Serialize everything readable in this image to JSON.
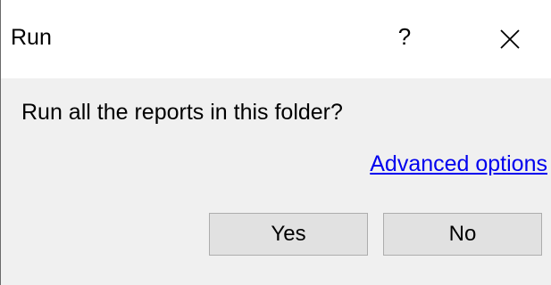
{
  "window": {
    "title": "Run",
    "help_label": "?",
    "close_icon": "close-icon"
  },
  "dialog": {
    "message": "Run all the reports in this folder?",
    "advanced_link": "Advanced options",
    "yes_label": "Yes",
    "no_label": "No"
  },
  "colors": {
    "titlebar_bg": "#ffffff",
    "content_bg": "#f0f0f0",
    "button_bg": "#e1e1e1",
    "button_border": "#adadad",
    "link": "#0000ee"
  }
}
